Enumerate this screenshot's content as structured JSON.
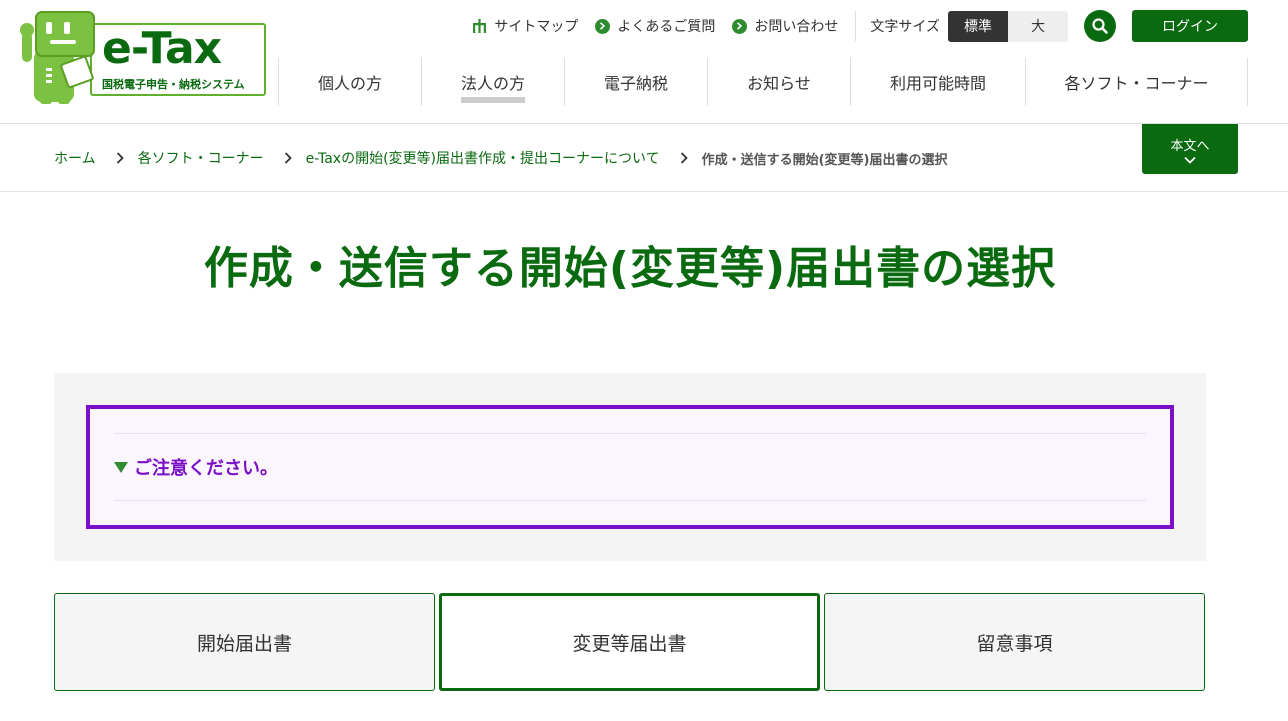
{
  "logo": {
    "brand": "e-Tax",
    "subtitle": "国税電子申告・納税システム"
  },
  "utility": {
    "sitemap": "サイトマップ",
    "faq": "よくあるご質問",
    "contact": "お問い合わせ",
    "font_size_label": "文字サイズ",
    "font_size_options": [
      "標準",
      "大"
    ],
    "font_size_selected": "標準",
    "login": "ログイン"
  },
  "global_nav": [
    {
      "label": "個人の方"
    },
    {
      "label": "法人の方",
      "current": true
    },
    {
      "label": "電子納税"
    },
    {
      "label": "お知らせ"
    },
    {
      "label": "利用可能時間"
    },
    {
      "label": "各ソフト・コーナー"
    }
  ],
  "breadcrumb": {
    "items": [
      "ホーム",
      "各ソフト・コーナー",
      "e-Taxの開始(変更等)届出書作成・提出コーナーについて"
    ],
    "current": "作成・送信する開始(変更等)届出書の選択"
  },
  "skip_button": "本文へ",
  "page_title": "作成・送信する開始(変更等)届出書の選択",
  "notice": {
    "title": "ご注意ください。"
  },
  "tabs": [
    {
      "label": "開始届出書"
    },
    {
      "label": "変更等届出書",
      "active": true
    },
    {
      "label": "留意事項"
    }
  ],
  "colors": {
    "brand_green": "#0a6a10",
    "logo_green": "#5fb12d",
    "notice_purple": "#7b0ec7",
    "icon_green": "#2e8b2e"
  }
}
